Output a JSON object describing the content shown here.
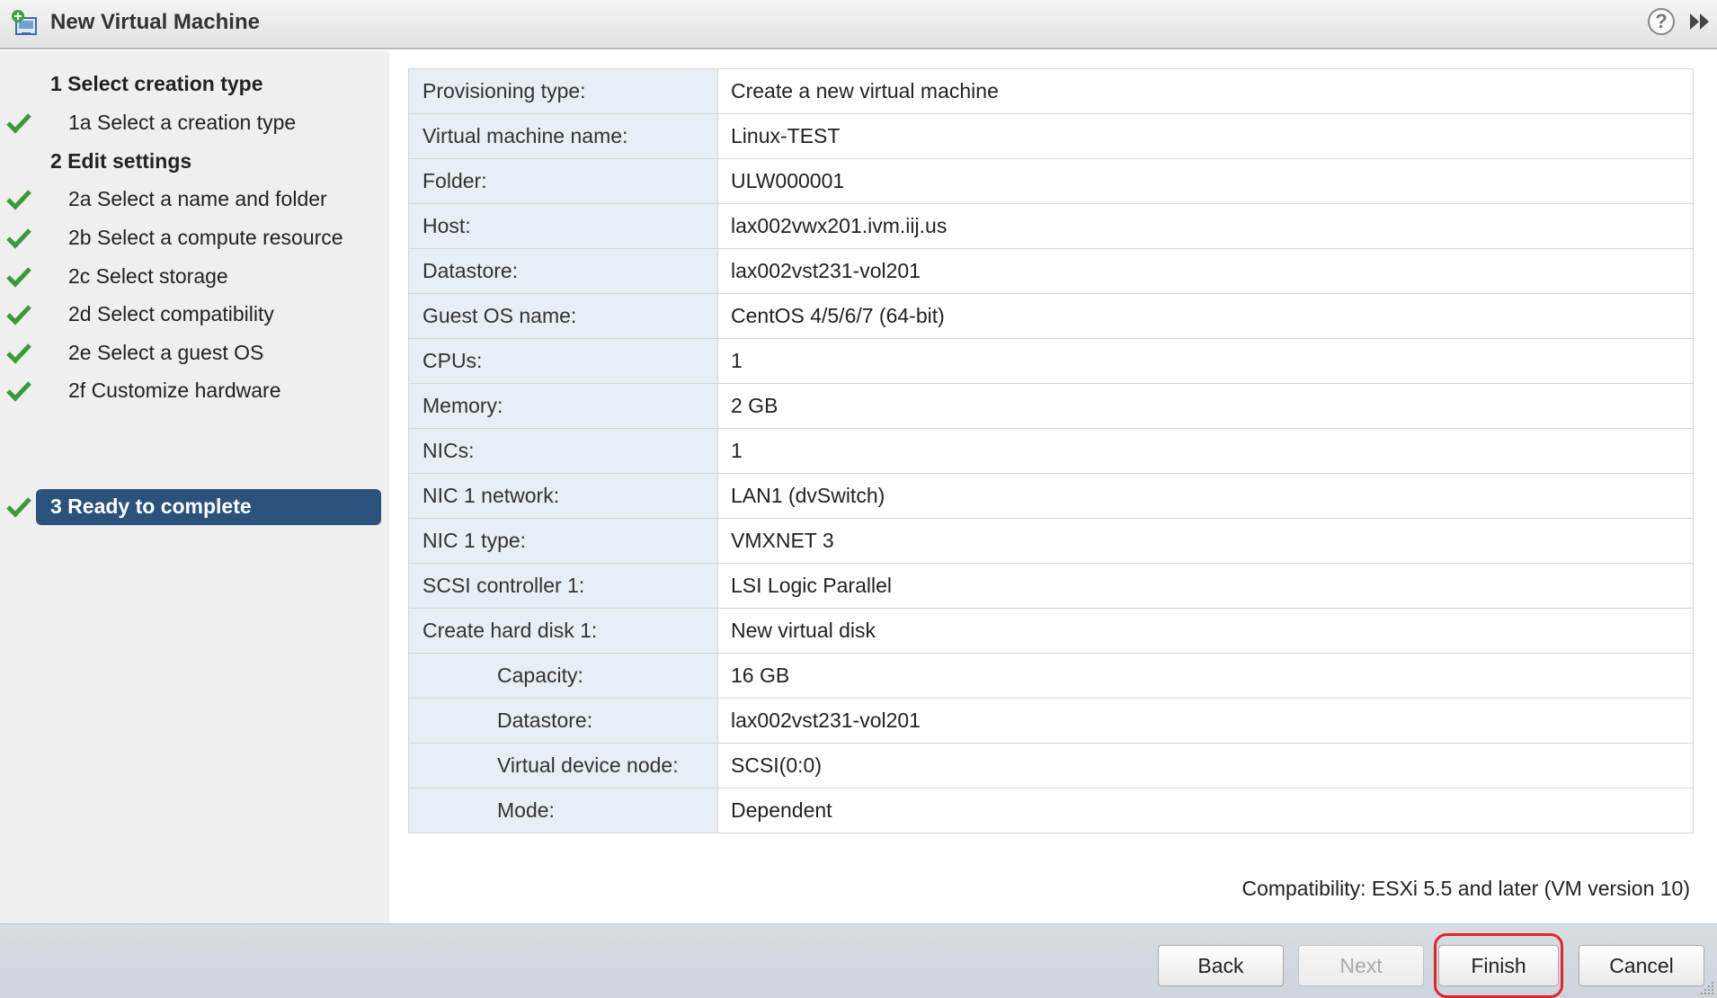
{
  "window": {
    "title": "New Virtual Machine",
    "help_glyph": "?"
  },
  "sidebar": {
    "steps": [
      {
        "label": "1  Select creation type",
        "kind": "header",
        "checked": false,
        "active": false
      },
      {
        "label": "1a  Select a creation type",
        "kind": "sub",
        "checked": true,
        "active": false
      },
      {
        "label": "2  Edit settings",
        "kind": "header",
        "checked": false,
        "active": false
      },
      {
        "label": "2a  Select a name and folder",
        "kind": "sub",
        "checked": true,
        "active": false
      },
      {
        "label": "2b  Select a compute resource",
        "kind": "sub",
        "checked": true,
        "active": false
      },
      {
        "label": "2c  Select storage",
        "kind": "sub",
        "checked": true,
        "active": false
      },
      {
        "label": "2d  Select compatibility",
        "kind": "sub",
        "checked": true,
        "active": false
      },
      {
        "label": "2e  Select a guest OS",
        "kind": "sub",
        "checked": true,
        "active": false
      },
      {
        "label": "2f  Customize hardware",
        "kind": "sub",
        "checked": true,
        "active": false
      },
      {
        "label": "3  Ready to complete",
        "kind": "header",
        "checked": true,
        "active": true
      }
    ]
  },
  "summary": {
    "rows": [
      {
        "key": "Provisioning type:",
        "value": "Create a new virtual machine",
        "indent": false
      },
      {
        "key": "Virtual machine name:",
        "value": "Linux-TEST",
        "indent": false
      },
      {
        "key": "Folder:",
        "value": "ULW000001",
        "indent": false
      },
      {
        "key": "Host:",
        "value": "lax002vwx201.ivm.iij.us",
        "indent": false
      },
      {
        "key": "Datastore:",
        "value": "lax002vst231-vol201",
        "indent": false
      },
      {
        "key": "Guest OS name:",
        "value": "CentOS 4/5/6/7 (64-bit)",
        "indent": false
      },
      {
        "key": "CPUs:",
        "value": "1",
        "indent": false
      },
      {
        "key": "Memory:",
        "value": "2 GB",
        "indent": false
      },
      {
        "key": "NICs:",
        "value": "1",
        "indent": false
      },
      {
        "key": "NIC 1 network:",
        "value": "LAN1 (dvSwitch)",
        "indent": false
      },
      {
        "key": "NIC 1 type:",
        "value": "VMXNET 3",
        "indent": false
      },
      {
        "key": "SCSI controller 1:",
        "value": "LSI Logic Parallel",
        "indent": false
      },
      {
        "key": "Create hard disk 1:",
        "value": "New virtual disk",
        "indent": false
      },
      {
        "key": "Capacity:",
        "value": "16 GB",
        "indent": true
      },
      {
        "key": "Datastore:",
        "value": "lax002vst231-vol201",
        "indent": true
      },
      {
        "key": "Virtual device node:",
        "value": "SCSI(0:0)",
        "indent": true
      },
      {
        "key": "Mode:",
        "value": "Dependent",
        "indent": true
      }
    ],
    "compatibility": "Compatibility: ESXi 5.5 and later (VM version 10)"
  },
  "footer": {
    "back_label": "Back",
    "next_label": "Next",
    "finish_label": "Finish",
    "cancel_label": "Cancel"
  },
  "colors": {
    "active_step": "#2a527c",
    "check_green": "#3a9a3a",
    "key_column": "#e6eef6",
    "highlight": "#e0262b"
  }
}
